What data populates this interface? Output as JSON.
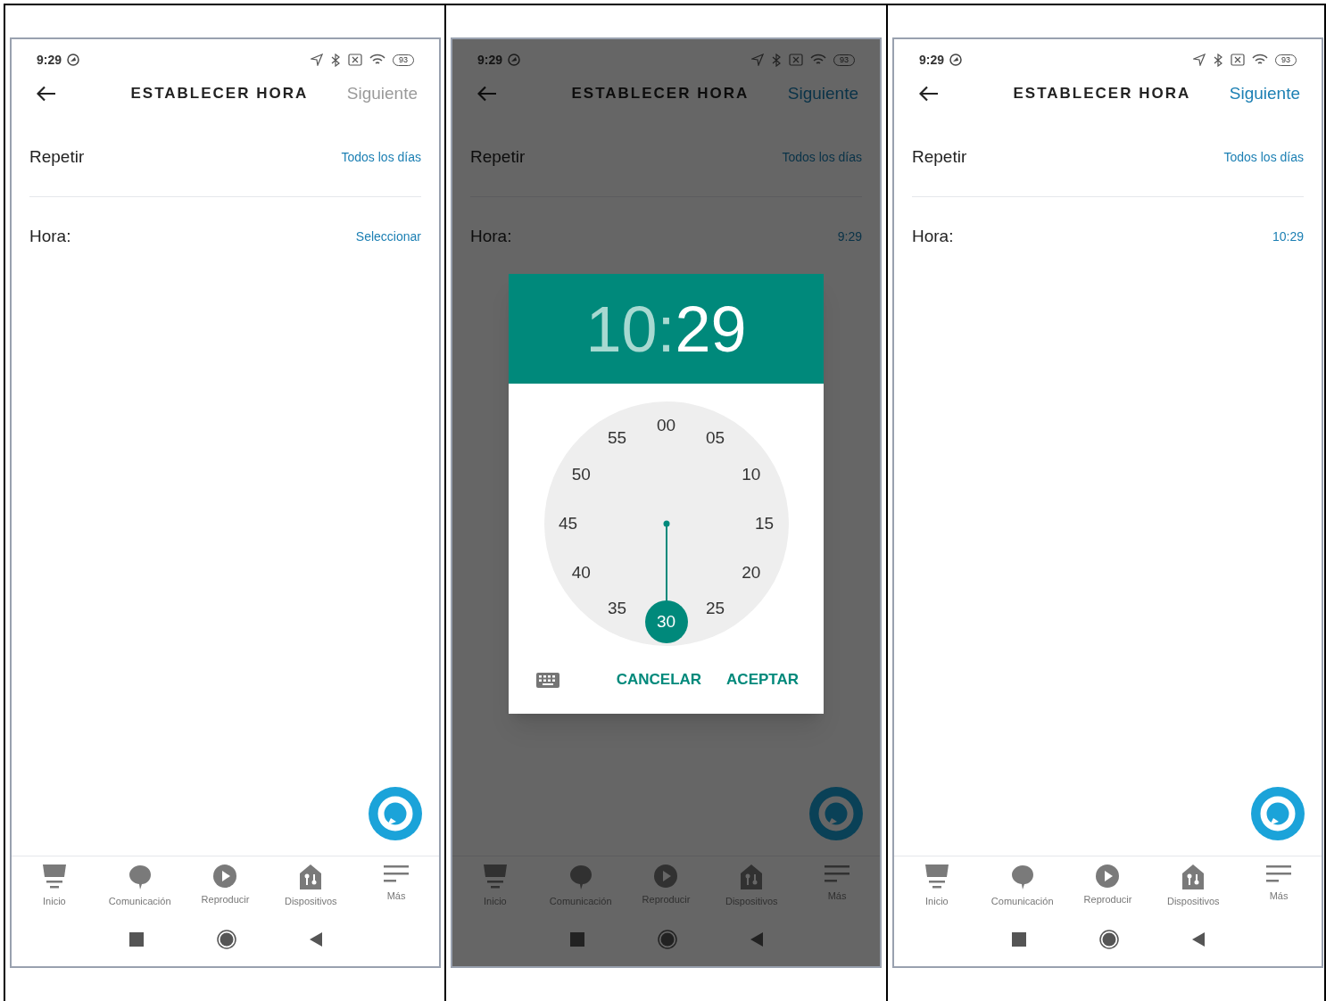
{
  "panels": [
    {
      "status": {
        "time": "9:29",
        "battery": "93"
      },
      "title": "ESTABLECER HORA",
      "next": {
        "label": "Siguiente",
        "enabled": false
      },
      "rows": [
        {
          "label": "Repetir",
          "value": "Todos los días"
        },
        {
          "label": "Hora:",
          "value": "Seleccionar"
        }
      ],
      "dimmed": false,
      "nav": [
        {
          "kind": "home",
          "label": "Inicio"
        },
        {
          "kind": "chat",
          "label": "Comunicación"
        },
        {
          "kind": "play",
          "label": "Reproducir"
        },
        {
          "kind": "devices",
          "label": "Dispositivos"
        },
        {
          "kind": "menu",
          "label": "Más"
        }
      ]
    },
    {
      "status": {
        "time": "9:29",
        "battery": "93"
      },
      "title": "ESTABLECER HORA",
      "next": {
        "label": "Siguiente",
        "enabled": true
      },
      "rows": [
        {
          "label": "Repetir",
          "value": "Todos los días"
        },
        {
          "label": "Hora:",
          "value": "9:29"
        }
      ],
      "dimmed": true,
      "nav": [
        {
          "kind": "home",
          "label": "Inicio"
        },
        {
          "kind": "chat",
          "label": "Comunicación"
        },
        {
          "kind": "play",
          "label": "Reproducir"
        },
        {
          "kind": "devices",
          "label": "Dispositivos"
        },
        {
          "kind": "menu",
          "label": "Más"
        }
      ],
      "dialog": {
        "hour": {
          "text": "10",
          "selected": false
        },
        "separator": ":",
        "minute": {
          "text": "29",
          "selected": true
        },
        "dial": [
          {
            "label": "00",
            "selected": false
          },
          {
            "label": "05",
            "selected": false
          },
          {
            "label": "10",
            "selected": false
          },
          {
            "label": "15",
            "selected": false
          },
          {
            "label": "20",
            "selected": false
          },
          {
            "label": "25",
            "selected": false
          },
          {
            "label": "30",
            "selected": true
          },
          {
            "label": "35",
            "selected": false
          },
          {
            "label": "40",
            "selected": false
          },
          {
            "label": "45",
            "selected": false
          },
          {
            "label": "50",
            "selected": false
          },
          {
            "label": "55",
            "selected": false
          }
        ],
        "buttons": [
          "CANCELAR",
          "ACEPTAR"
        ]
      }
    },
    {
      "status": {
        "time": "9:29",
        "battery": "93"
      },
      "title": "ESTABLECER HORA",
      "next": {
        "label": "Siguiente",
        "enabled": true
      },
      "rows": [
        {
          "label": "Repetir",
          "value": "Todos los días"
        },
        {
          "label": "Hora:",
          "value": "10:29"
        }
      ],
      "dimmed": false,
      "nav": [
        {
          "kind": "home",
          "label": "Inicio"
        },
        {
          "kind": "chat",
          "label": "Comunicación"
        },
        {
          "kind": "play",
          "label": "Reproducir"
        },
        {
          "kind": "devices",
          "label": "Dispositivos"
        },
        {
          "kind": "menu",
          "label": "Más"
        }
      ]
    }
  ]
}
